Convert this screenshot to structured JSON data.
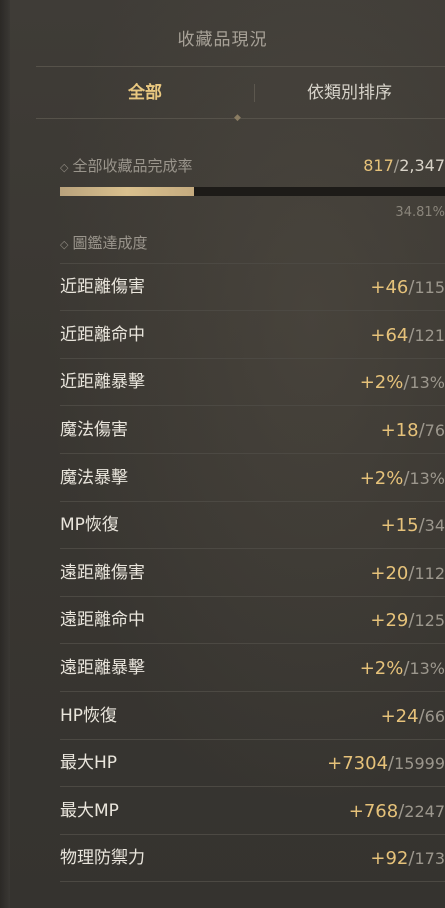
{
  "header": {
    "title": "收藏品現況"
  },
  "tabs": [
    {
      "label": "全部",
      "active": true
    },
    {
      "label": "依類別排序",
      "active": false
    }
  ],
  "completion": {
    "label": "全部收藏品完成率",
    "collected": "817",
    "separator": "/",
    "total": "2,347",
    "progress": 0.3481,
    "percent_text": "34.81%"
  },
  "codex": {
    "label": "圖鑑達成度"
  },
  "stats": [
    {
      "name": "近距離傷害",
      "bonus": "+46",
      "max": "115"
    },
    {
      "name": "近距離命中",
      "bonus": "+64",
      "max": "121"
    },
    {
      "name": "近距離暴擊",
      "bonus": "+2%",
      "max": "13%"
    },
    {
      "name": "魔法傷害",
      "bonus": "+18",
      "max": "76"
    },
    {
      "name": "魔法暴擊",
      "bonus": "+2%",
      "max": "13%"
    },
    {
      "name": "MP恢復",
      "bonus": "+15",
      "max": "34"
    },
    {
      "name": "遠距離傷害",
      "bonus": "+20",
      "max": "112"
    },
    {
      "name": "遠距離命中",
      "bonus": "+29",
      "max": "125"
    },
    {
      "name": "遠距離暴擊",
      "bonus": "+2%",
      "max": "13%"
    },
    {
      "name": "HP恢復",
      "bonus": "+24",
      "max": "66"
    },
    {
      "name": "最大HP",
      "bonus": "+7304",
      "max": "15999"
    },
    {
      "name": "最大MP",
      "bonus": "+768",
      "max": "2247"
    },
    {
      "name": "物理防禦力",
      "bonus": "+92",
      "max": "173"
    }
  ],
  "colors": {
    "accent_gold": "#e6c27a",
    "text_light": "#e9e5dc",
    "text_muted": "#9c978d"
  },
  "icons": {
    "section_marker": "diamond-outline-icon"
  }
}
